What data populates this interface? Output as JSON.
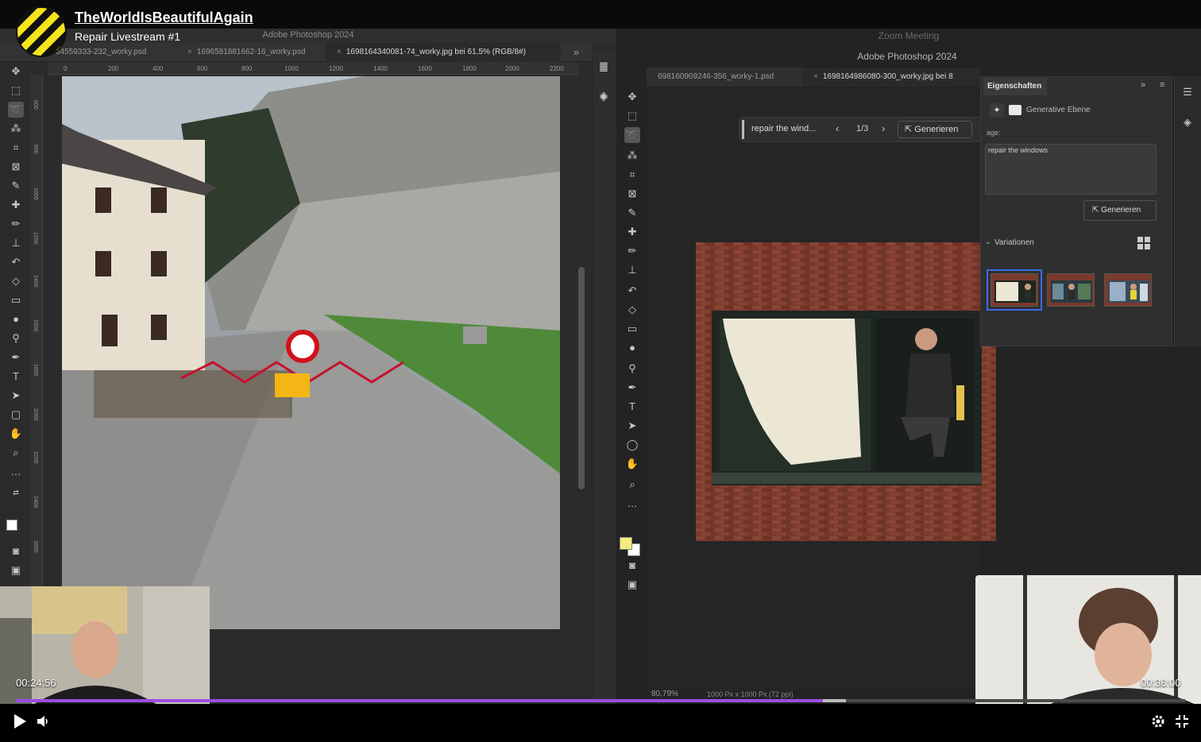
{
  "video": {
    "channel": "TheWorldIsBeautifulAgain",
    "title": "Repair Livestream #1",
    "timestamp_left": "00:24:56",
    "timestamp_right": "00:36:00",
    "progress": 0.69,
    "buffered": 0.71,
    "accent_color": "#9b4de3"
  },
  "ps_left": {
    "app_title": "Adobe Photoshop 2024",
    "tabs": [
      {
        "label": "54559333-232_worky.psd",
        "active": false
      },
      {
        "label": "1696581881662-16_worky.psd",
        "active": false
      },
      {
        "label": "1698164340081-74_worky.jpg bei 61,5% (RGB/8#)",
        "active": true
      }
    ],
    "more_tabs": "»",
    "ruler_top": [
      "0",
      "200",
      "400",
      "600",
      "800",
      "1000",
      "1200",
      "1400",
      "1600",
      "1800",
      "2000",
      "2200"
    ],
    "ruler_left": [
      "600",
      "800",
      "1000",
      "1200",
      "1400",
      "1600",
      "1800",
      "2000",
      "2200",
      "2400",
      "2600"
    ]
  },
  "zoom": {
    "window_title": "Zoom Meeting"
  },
  "ps_right": {
    "app_title": "Adobe Photoshop 2024",
    "tabs": [
      {
        "label": "698160909246-356_worky-1.psd",
        "active": false
      },
      {
        "label": "1698164986080-300_worky.jpg bei 8",
        "active": true
      }
    ],
    "prompt_bar": {
      "text": "repair the wind...",
      "prev": "‹",
      "count": "1/3",
      "next": "›",
      "generate": "Generieren",
      "more": "···"
    },
    "status_zoom": "80,79%",
    "status_size": "1000 Px x 1000 Px (72 ppi)"
  },
  "properties": {
    "tab": "Eigenschaften",
    "layer_type": "Generative Ebene",
    "prompt_label": "age:",
    "prompt_text": "repair the windows",
    "generate": "Generieren",
    "variations_label": "Variationen",
    "selected_variation": 0
  },
  "icons": {
    "play": "play-icon",
    "volume": "volume-icon",
    "settings": "gear-icon",
    "fullscreen": "fullscreen-exit-icon"
  }
}
